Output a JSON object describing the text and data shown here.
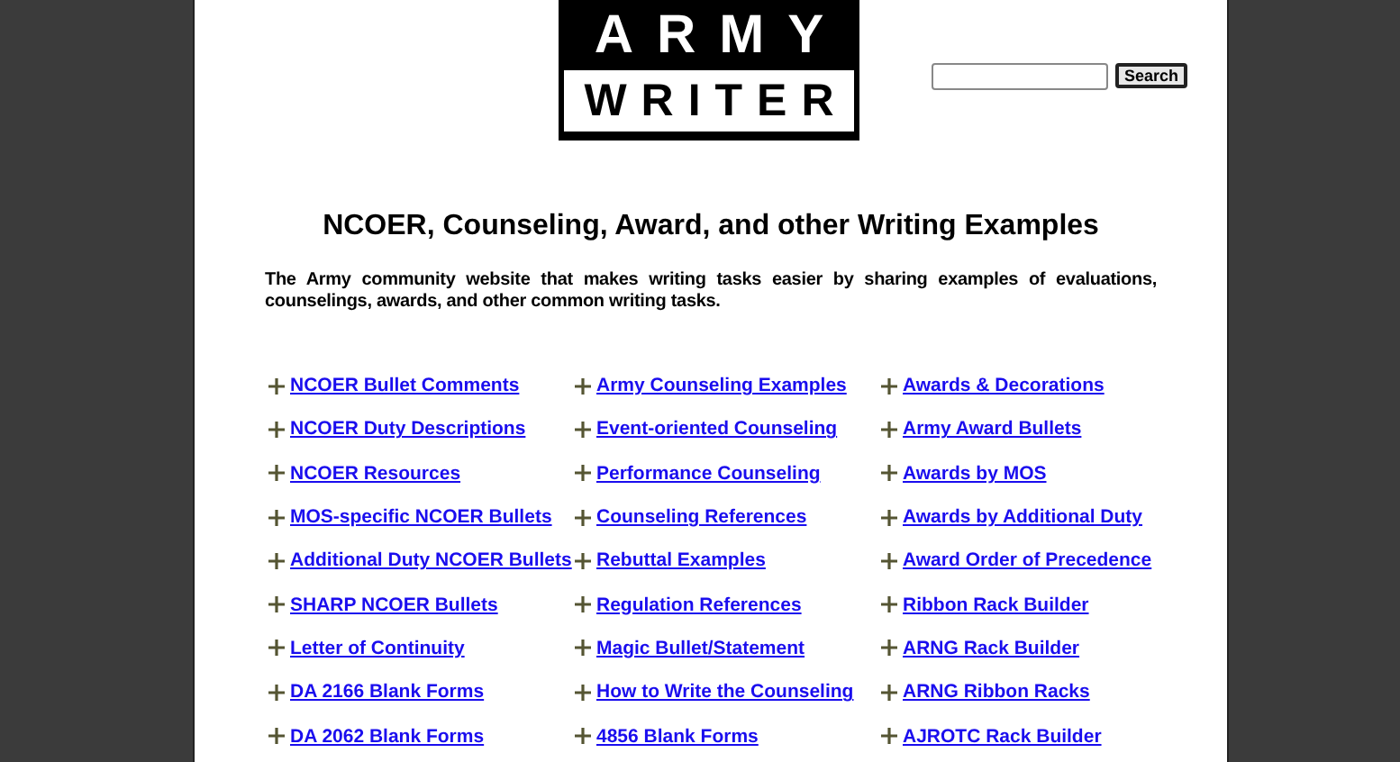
{
  "logo": {
    "top": "ARMY",
    "bottom": "WRITER"
  },
  "search": {
    "button": "Search"
  },
  "heading": "NCOER, Counseling, Award, and other Writing Examples",
  "intro": "The Army community website that makes writing tasks easier by sharing examples of evaluations, counselings, awards, and other common writing tasks.",
  "link_columns": [
    [
      "NCOER Bullet Comments",
      "NCOER Duty Descriptions",
      "NCOER Resources",
      "MOS-specific NCOER Bullets",
      "Additional Duty NCOER Bullets",
      "SHARP NCOER Bullets",
      "Letter of Continuity",
      "DA 2166 Blank Forms",
      "DA 2062 Blank Forms"
    ],
    [
      "Army Counseling Examples",
      "Event-oriented Counseling",
      "Performance Counseling",
      "Counseling References",
      "Rebuttal Examples",
      "Regulation References",
      "Magic Bullet/Statement",
      "How to Write the Counseling",
      "4856 Blank Forms"
    ],
    [
      "Awards & Decorations",
      "Army Award Bullets",
      "Awards by MOS",
      "Awards by Additional Duty",
      "Award Order of Precedence",
      "Ribbon Rack Builder",
      "ARNG Rack Builder",
      "ARNG Ribbon Racks",
      "AJROTC Rack Builder"
    ]
  ]
}
